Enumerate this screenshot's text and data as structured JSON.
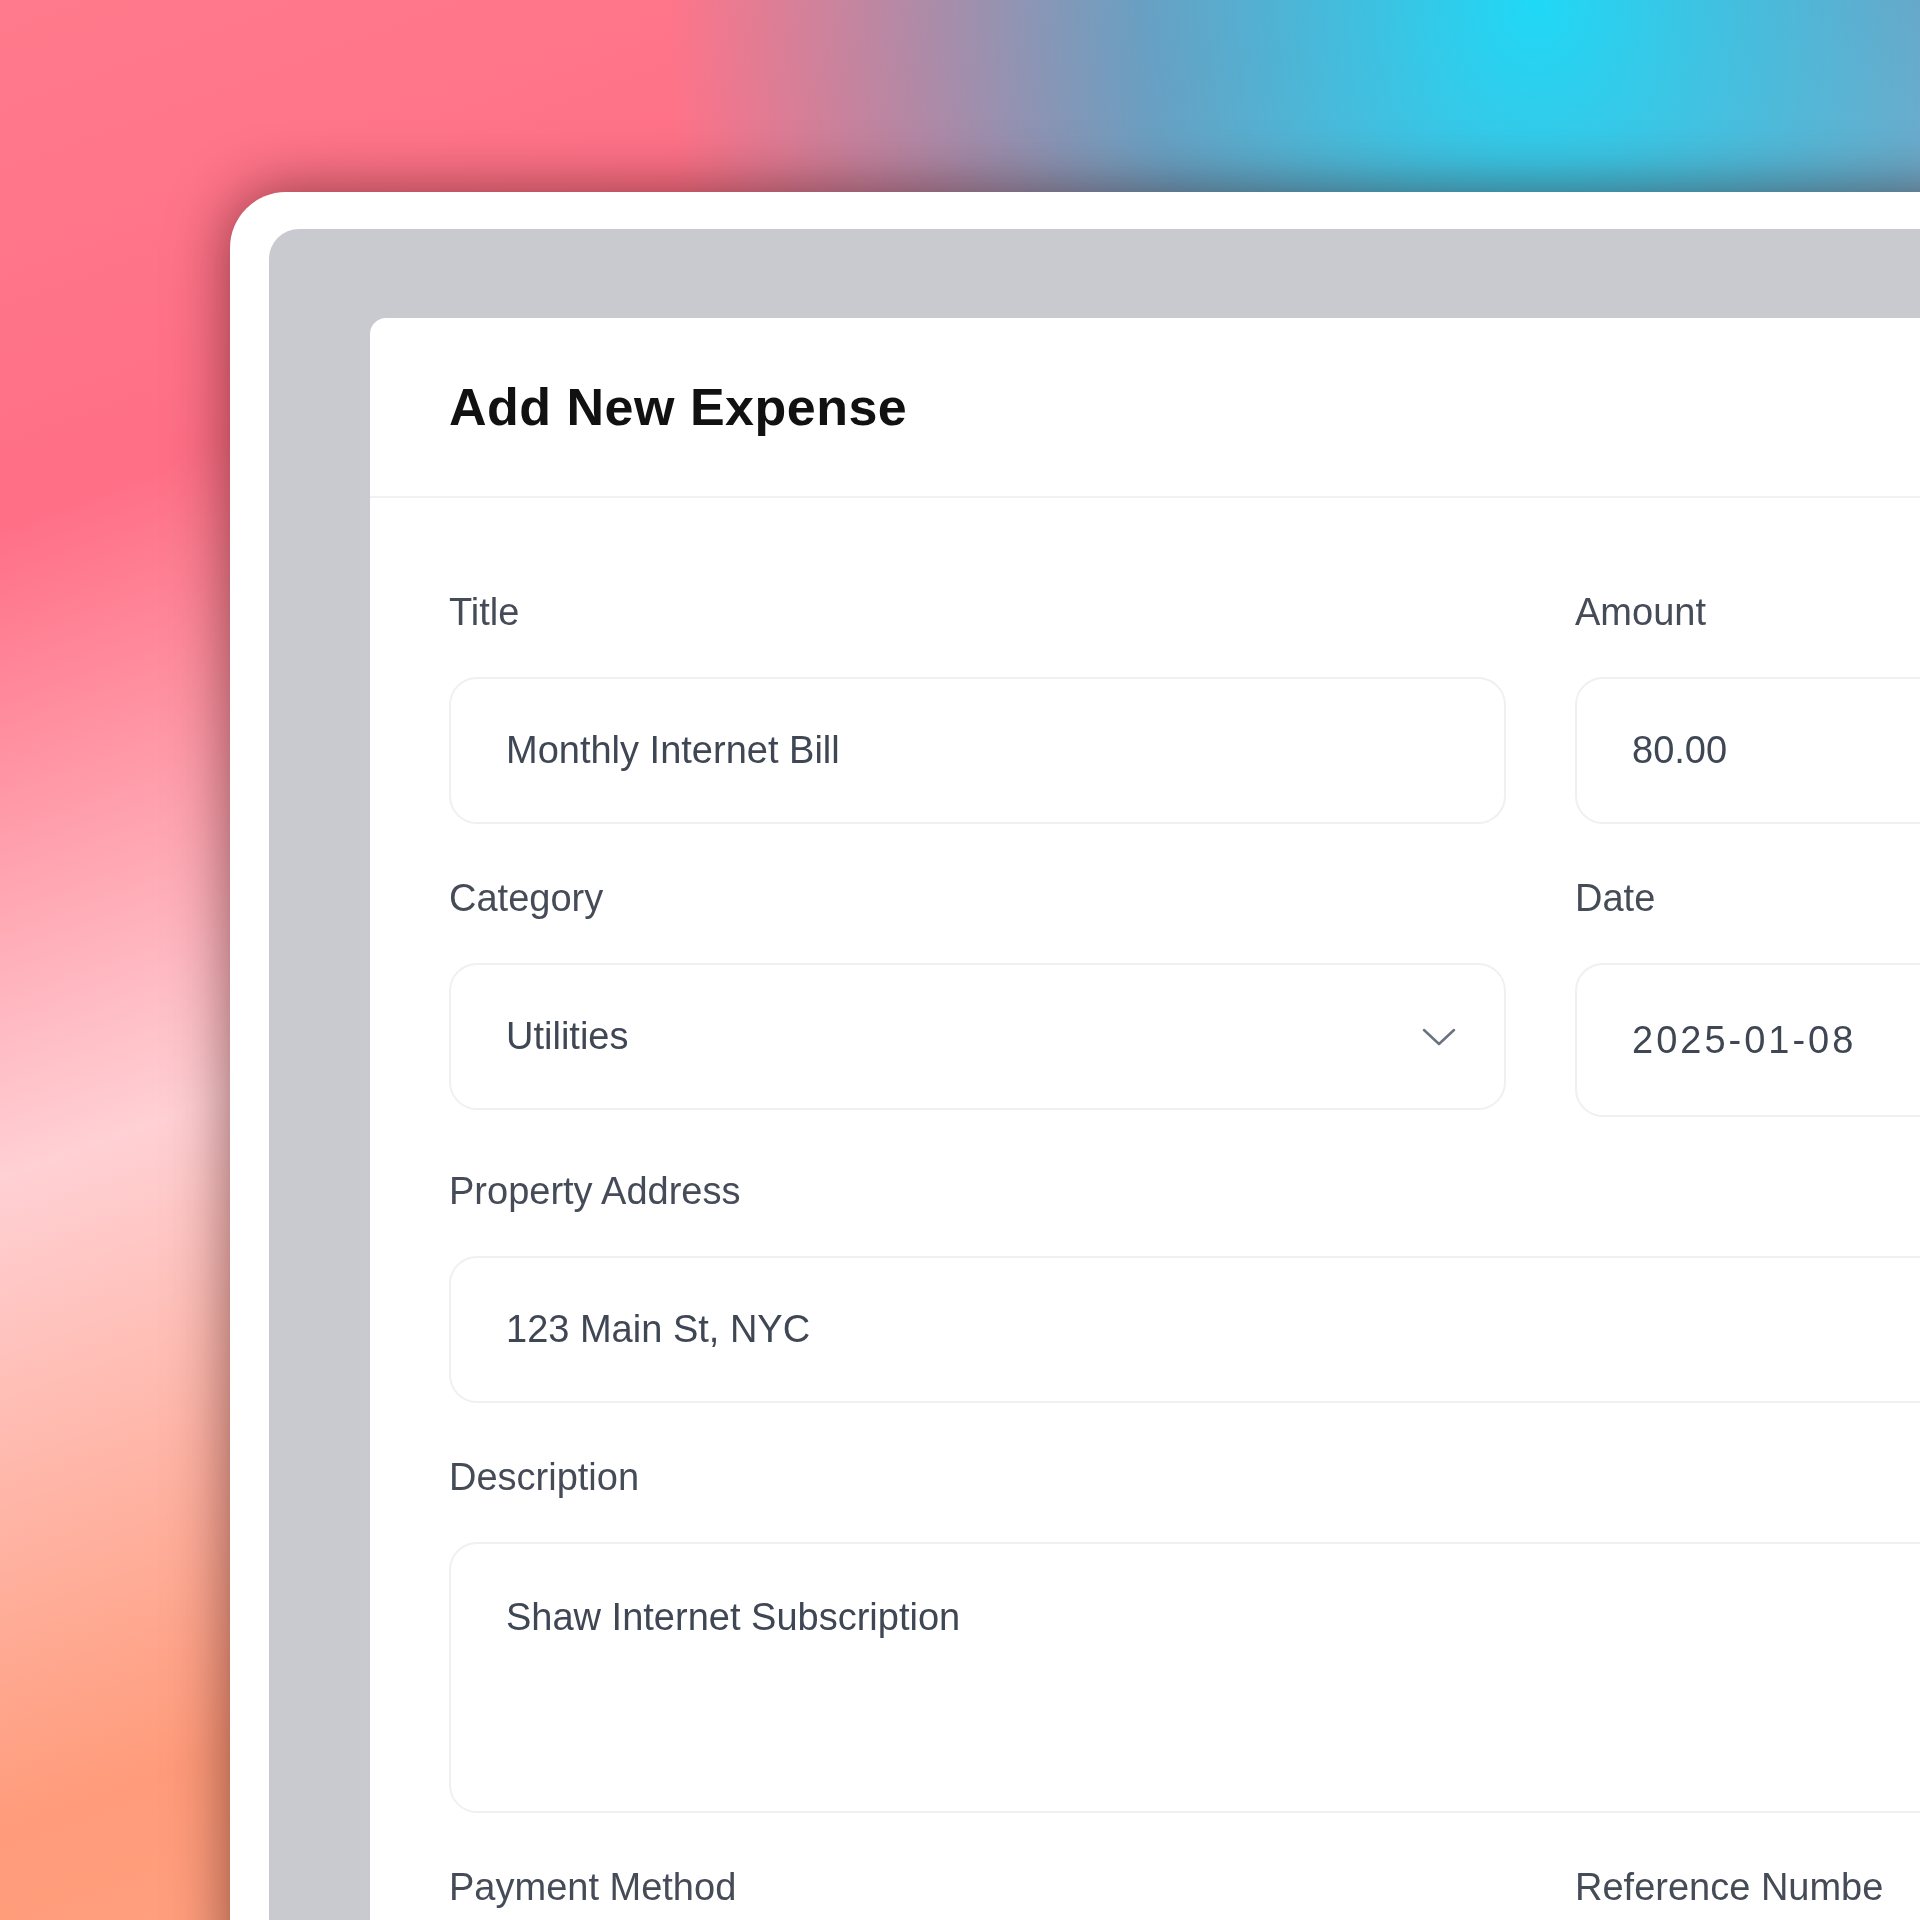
{
  "dialog": {
    "title": "Add New Expense"
  },
  "rows": [
    [
      {
        "label": "Title",
        "kind": "text",
        "value": "Monthly Internet Bill"
      },
      {
        "label": "Amount",
        "kind": "text",
        "value": "80.00"
      }
    ],
    [
      {
        "label": "Category",
        "kind": "select",
        "value": "Utilities"
      },
      {
        "label": "Date",
        "kind": "date",
        "value": "2025-01-08"
      }
    ],
    [
      {
        "label": "Property Address",
        "kind": "text",
        "value": "123 Main St, NYC"
      }
    ],
    [
      {
        "label": "Description",
        "kind": "textarea",
        "value": "Shaw Internet Subscription"
      }
    ],
    [
      {
        "label": "Payment Method"
      },
      {
        "label": "Reference Numbe"
      }
    ]
  ]
}
